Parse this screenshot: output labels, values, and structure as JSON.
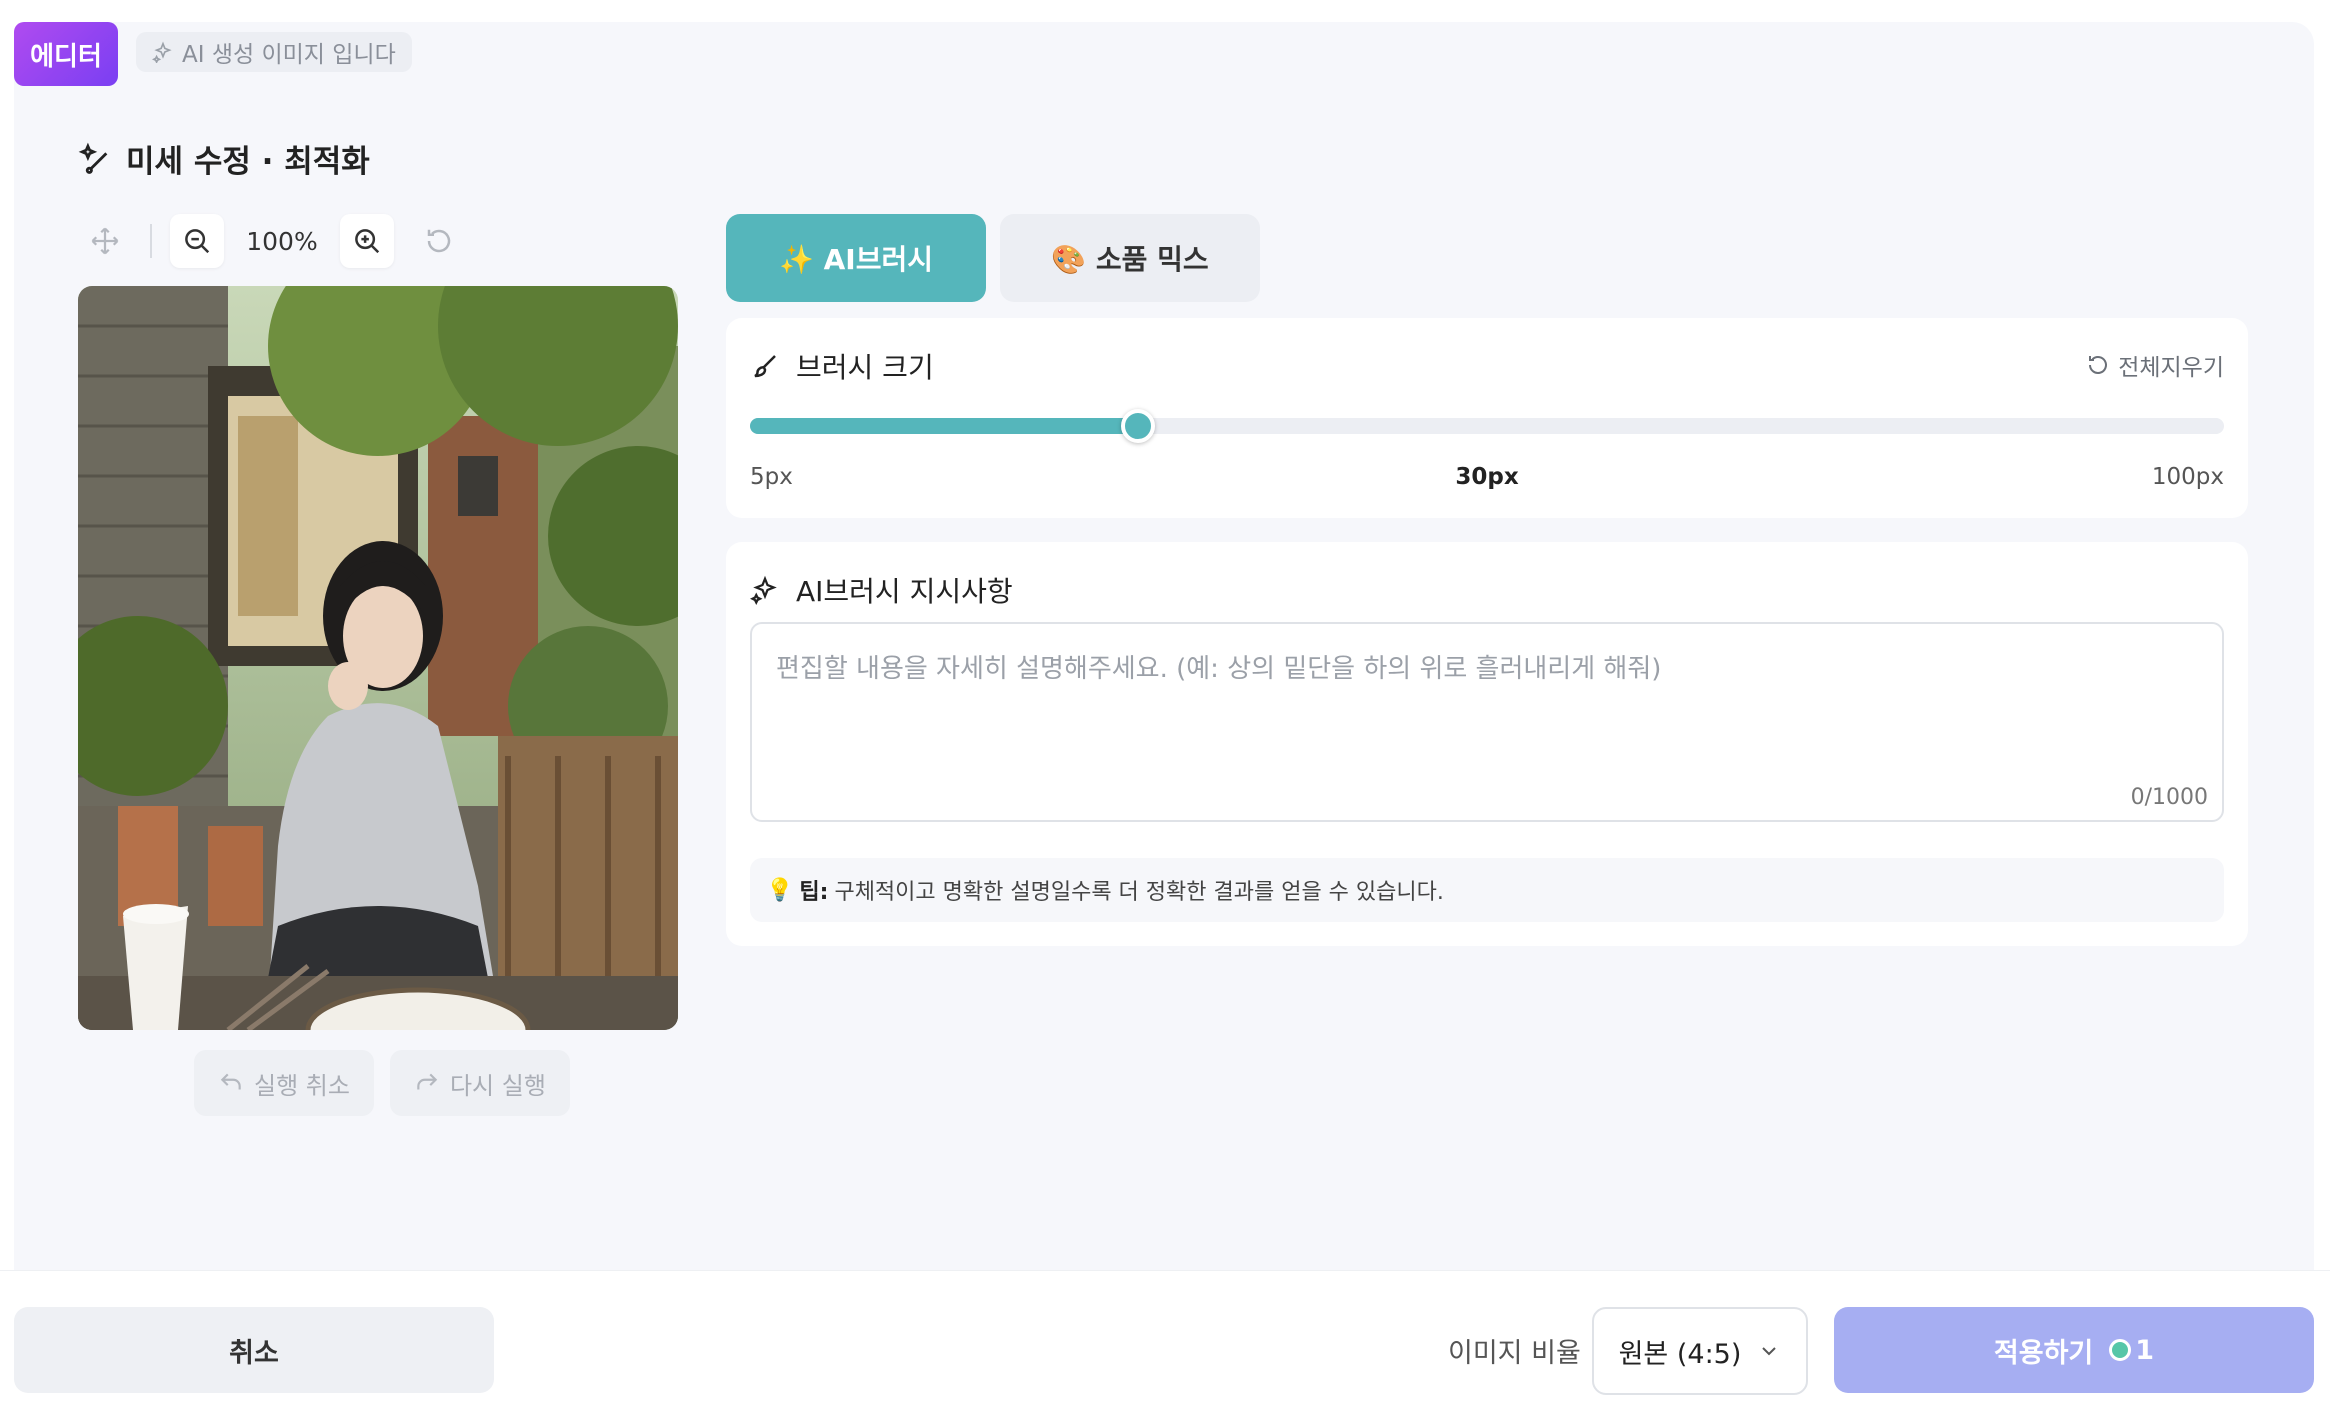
{
  "header": {
    "badge": "에디터",
    "ai_tag": "AI 생성 이미지 입니다"
  },
  "section": {
    "title": "미세 수정 · 최적화"
  },
  "toolbar": {
    "zoom": "100%"
  },
  "history": {
    "undo_label": "실행 취소",
    "redo_label": "다시 실행"
  },
  "modes": [
    {
      "label": "✨ AI브러시",
      "active": true
    },
    {
      "label": "🎨 소품 믹스",
      "active": false
    }
  ],
  "brush": {
    "title": "브러시 크기",
    "reset_label": "전체지우기",
    "min_label": "5px",
    "max_label": "100px",
    "current_label": "30px",
    "min": 5,
    "max": 100,
    "value": 30
  },
  "instructions": {
    "title": "AI브러시 지시사항",
    "placeholder": "편집할 내용을 자세히 설명해주세요. (예: 상의 밑단을 하의 위로 흘러내리게 해줘)",
    "char_count": "0/1000",
    "tip_label": "팁:",
    "tip_text": "구체적이고 명확한 설명일수록 더 정확한 결과를 얻을 수 있습니다."
  },
  "footer": {
    "cancel_label": "취소",
    "ratio_label": "이미지 비율",
    "ratio_value": "원본 (4:5)",
    "apply_label": "적용하기",
    "credit": "1"
  },
  "colors": {
    "accent": "#55b6bb",
    "apply": "#a6aef2",
    "badge": "#8a44f0"
  }
}
